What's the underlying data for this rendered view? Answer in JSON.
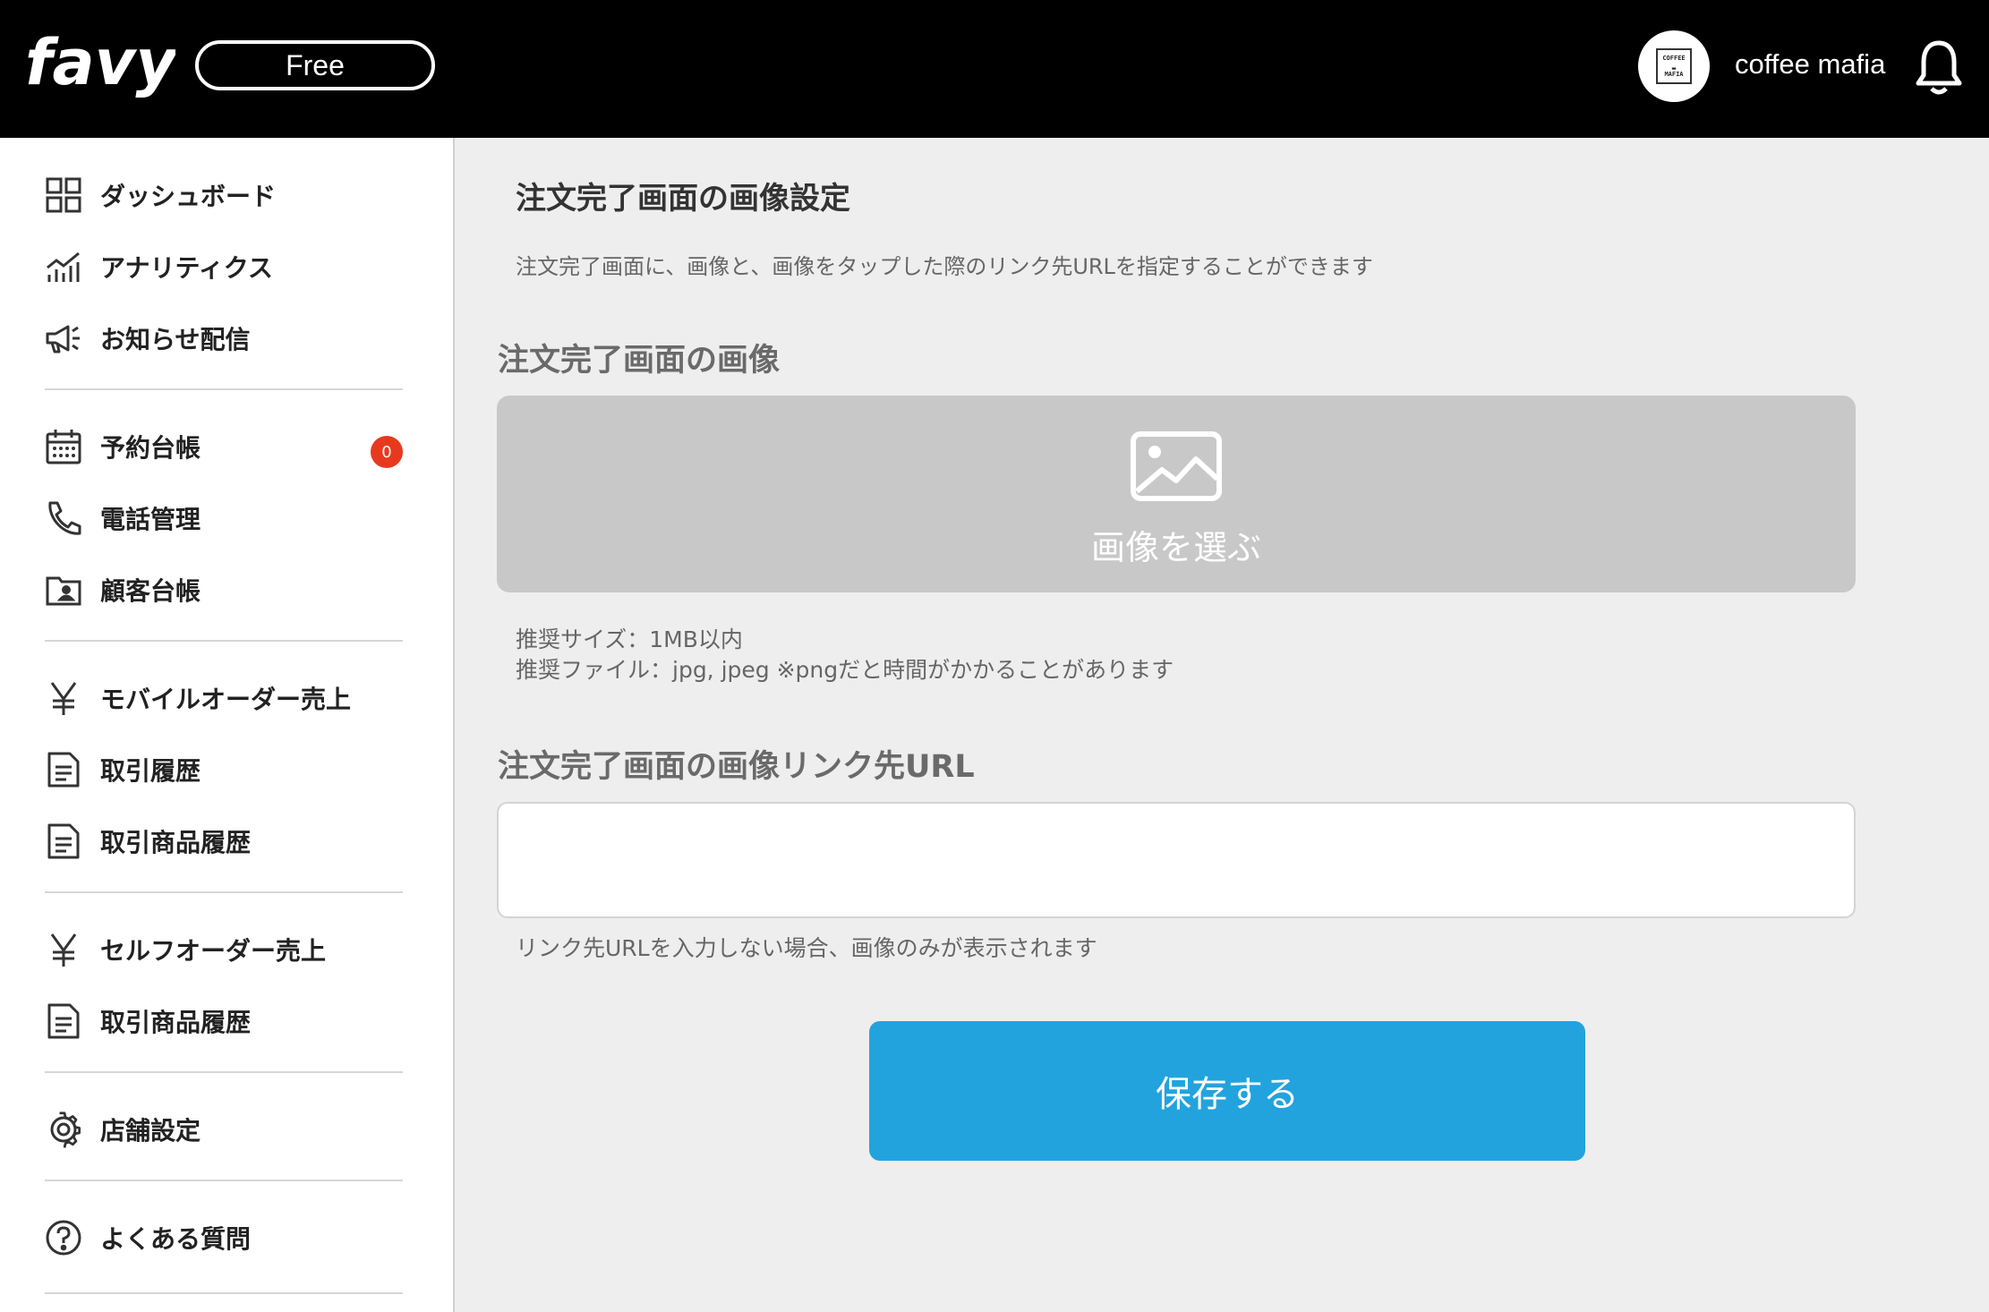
{
  "header": {
    "logo_text": "favy",
    "plan": "Free",
    "shop_name": "coffee mafia",
    "avatar_text_top": "COFFEE",
    "avatar_text_bottom": "MAFIA"
  },
  "sidebar": {
    "groups": [
      [
        {
          "label": "ダッシュボード",
          "icon": "dashboard-grid-icon"
        },
        {
          "label": "アナリティクス",
          "icon": "analytics-chart-icon"
        },
        {
          "label": "お知らせ配信",
          "icon": "megaphone-icon"
        }
      ],
      [
        {
          "label": "予約台帳",
          "icon": "calendar-icon",
          "badge": "0"
        },
        {
          "label": "電話管理",
          "icon": "phone-icon"
        },
        {
          "label": "顧客台帳",
          "icon": "customer-folder-icon"
        }
      ],
      [
        {
          "label": "モバイルオーダー売上",
          "icon": "yen-icon"
        },
        {
          "label": "取引履歴",
          "icon": "document-icon"
        },
        {
          "label": "取引商品履歴",
          "icon": "document-icon"
        }
      ],
      [
        {
          "label": "セルフオーダー売上",
          "icon": "yen-icon"
        },
        {
          "label": "取引商品履歴",
          "icon": "document-icon"
        }
      ],
      [
        {
          "label": "店舗設定",
          "icon": "gear-icon"
        }
      ],
      [
        {
          "label": "よくある質問",
          "icon": "help-icon"
        }
      ]
    ]
  },
  "main": {
    "title": "注文完了画面の画像設定",
    "description": "注文完了画面に、画像と、画像をタップした際のリンク先URLを指定することができます",
    "image_section_title": "注文完了画面の画像",
    "image_picker_label": "画像を選ぶ",
    "recommend_size": "推奨サイズ：1MB以内",
    "recommend_file": "推奨ファイル：jpg, jpeg ※pngだと時間がかかることがあります",
    "url_section_title": "注文完了画面の画像リンク先URL",
    "url_value": "",
    "url_placeholder": "",
    "url_note": "リンク先URLを入力しない場合、画像のみが表示されます",
    "save_label": "保存する"
  },
  "colors": {
    "header_bg": "#000000",
    "accent": "#22a3de",
    "badge": "#e8391f",
    "picker_bg": "#c8c8c8"
  }
}
